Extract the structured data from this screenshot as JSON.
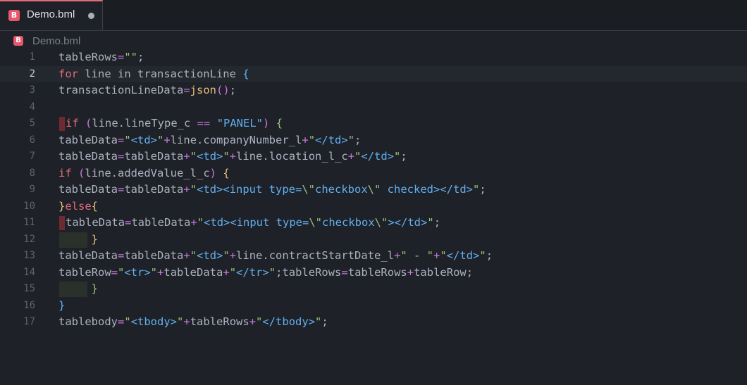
{
  "tab": {
    "icon_letter": "B",
    "title": "Demo.bml",
    "modified": true
  },
  "breadcrumb": {
    "icon_letter": "B",
    "file": "Demo.bml"
  },
  "colors": {
    "background": "#1e2127",
    "keyword": "#e06c75",
    "string": "#98c379",
    "tag": "#61afef",
    "operator": "#c678dd",
    "function": "#e5c07b"
  },
  "editor": {
    "active_line": 2,
    "lines": [
      {
        "num": "1",
        "tokens": [
          [
            "var",
            "tableRows"
          ],
          [
            "op",
            "="
          ],
          [
            "str",
            "\"\""
          ],
          [
            "pun",
            ";"
          ]
        ]
      },
      {
        "num": "2",
        "tokens": [
          [
            "kw",
            "for"
          ],
          [
            "var",
            " line in transactionLine "
          ],
          [
            "br2",
            "{"
          ]
        ]
      },
      {
        "num": "3",
        "tokens": [
          [
            "var",
            "transactionLineData"
          ],
          [
            "op",
            "="
          ],
          [
            "fn",
            "json"
          ],
          [
            "br1",
            "()"
          ],
          [
            "pun",
            ";"
          ]
        ]
      },
      {
        "num": "4",
        "tokens": []
      },
      {
        "num": "5",
        "mark": "gutter",
        "tokens": [
          [
            "kw",
            "if"
          ],
          [
            "var",
            " "
          ],
          [
            "br1",
            "("
          ],
          [
            "var",
            "line.lineType_c "
          ],
          [
            "op",
            "=="
          ],
          [
            "var",
            " "
          ],
          [
            "tag",
            "\"PANEL\""
          ],
          [
            "br1",
            ")"
          ],
          [
            "var",
            " "
          ],
          [
            "br3",
            "{"
          ]
        ]
      },
      {
        "num": "6",
        "tokens": [
          [
            "var",
            "tableData"
          ],
          [
            "op",
            "="
          ],
          [
            "str",
            "\""
          ],
          [
            "tag",
            "<td>"
          ],
          [
            "str",
            "\""
          ],
          [
            "op",
            "+"
          ],
          [
            "var",
            "line.companyNumber_l"
          ],
          [
            "op",
            "+"
          ],
          [
            "str",
            "\""
          ],
          [
            "tag",
            "</td>"
          ],
          [
            "str",
            "\""
          ],
          [
            "pun",
            ";"
          ]
        ]
      },
      {
        "num": "7",
        "tokens": [
          [
            "var",
            "tableData"
          ],
          [
            "op",
            "="
          ],
          [
            "var",
            "tableData"
          ],
          [
            "op",
            "+"
          ],
          [
            "str",
            "\""
          ],
          [
            "tag",
            "<td>"
          ],
          [
            "str",
            "\""
          ],
          [
            "op",
            "+"
          ],
          [
            "var",
            "line.location_l_c"
          ],
          [
            "op",
            "+"
          ],
          [
            "str",
            "\""
          ],
          [
            "tag",
            "</td>"
          ],
          [
            "str",
            "\""
          ],
          [
            "pun",
            ";"
          ]
        ]
      },
      {
        "num": "8",
        "tokens": [
          [
            "kw",
            "if"
          ],
          [
            "var",
            " "
          ],
          [
            "br1",
            "("
          ],
          [
            "var",
            "line.addedValue_l_c"
          ],
          [
            "br1",
            ")"
          ],
          [
            "var",
            " "
          ],
          [
            "fn",
            "{"
          ]
        ]
      },
      {
        "num": "9",
        "tokens": [
          [
            "var",
            "tableData"
          ],
          [
            "op",
            "="
          ],
          [
            "var",
            "tableData"
          ],
          [
            "op",
            "+"
          ],
          [
            "str",
            "\""
          ],
          [
            "tag",
            "<td><input type="
          ],
          [
            "str",
            "\\\""
          ],
          [
            "tag",
            "checkbox"
          ],
          [
            "str",
            "\\\""
          ],
          [
            "tag",
            " checked></td>"
          ],
          [
            "str",
            "\""
          ],
          [
            "pun",
            ";"
          ]
        ]
      },
      {
        "num": "10",
        "tokens": [
          [
            "fn",
            "}"
          ],
          [
            "kw",
            "else"
          ],
          [
            "fn",
            "{"
          ]
        ]
      },
      {
        "num": "11",
        "mark": "gutter",
        "tokens": [
          [
            "var",
            "tableData"
          ],
          [
            "op",
            "="
          ],
          [
            "var",
            "tableData"
          ],
          [
            "op",
            "+"
          ],
          [
            "str",
            "\""
          ],
          [
            "tag",
            "<td><input type="
          ],
          [
            "str",
            "\\\""
          ],
          [
            "tag",
            "checkbox"
          ],
          [
            "str",
            "\\\""
          ],
          [
            "tag",
            "></td>"
          ],
          [
            "str",
            "\""
          ],
          [
            "pun",
            ";"
          ]
        ]
      },
      {
        "num": "12",
        "mark": "ws",
        "tokens": [
          [
            "var",
            "     "
          ],
          [
            "fn",
            "}"
          ]
        ]
      },
      {
        "num": "13",
        "tokens": [
          [
            "var",
            "tableData"
          ],
          [
            "op",
            "="
          ],
          [
            "var",
            "tableData"
          ],
          [
            "op",
            "+"
          ],
          [
            "str",
            "\""
          ],
          [
            "tag",
            "<td>"
          ],
          [
            "str",
            "\""
          ],
          [
            "op",
            "+"
          ],
          [
            "var",
            "line.contractStartDate_l"
          ],
          [
            "op",
            "+"
          ],
          [
            "str",
            "\" - \""
          ],
          [
            "op",
            "+"
          ],
          [
            "str",
            "\""
          ],
          [
            "tag",
            "</td>"
          ],
          [
            "str",
            "\""
          ],
          [
            "pun",
            ";"
          ]
        ]
      },
      {
        "num": "14",
        "tokens": [
          [
            "var",
            "tableRow"
          ],
          [
            "op",
            "="
          ],
          [
            "str",
            "\""
          ],
          [
            "tag",
            "<tr>"
          ],
          [
            "str",
            "\""
          ],
          [
            "op",
            "+"
          ],
          [
            "var",
            "tableData"
          ],
          [
            "op",
            "+"
          ],
          [
            "str",
            "\""
          ],
          [
            "tag",
            "</tr>"
          ],
          [
            "str",
            "\""
          ],
          [
            "pun",
            ";"
          ],
          [
            "var",
            "tableRows"
          ],
          [
            "op",
            "="
          ],
          [
            "var",
            "tableRows"
          ],
          [
            "op",
            "+"
          ],
          [
            "var",
            "tableRow"
          ],
          [
            "pun",
            ";"
          ]
        ]
      },
      {
        "num": "15",
        "mark": "ws",
        "tokens": [
          [
            "var",
            "     "
          ],
          [
            "br3",
            "}"
          ]
        ]
      },
      {
        "num": "16",
        "tokens": [
          [
            "br2",
            "}"
          ]
        ]
      },
      {
        "num": "17",
        "tokens": [
          [
            "var",
            "tablebody"
          ],
          [
            "op",
            "="
          ],
          [
            "str",
            "\""
          ],
          [
            "tag",
            "<tbody>"
          ],
          [
            "str",
            "\""
          ],
          [
            "op",
            "+"
          ],
          [
            "var",
            "tableRows"
          ],
          [
            "op",
            "+"
          ],
          [
            "str",
            "\""
          ],
          [
            "tag",
            "</tbody>"
          ],
          [
            "str",
            "\""
          ],
          [
            "pun",
            ";"
          ]
        ]
      }
    ]
  }
}
